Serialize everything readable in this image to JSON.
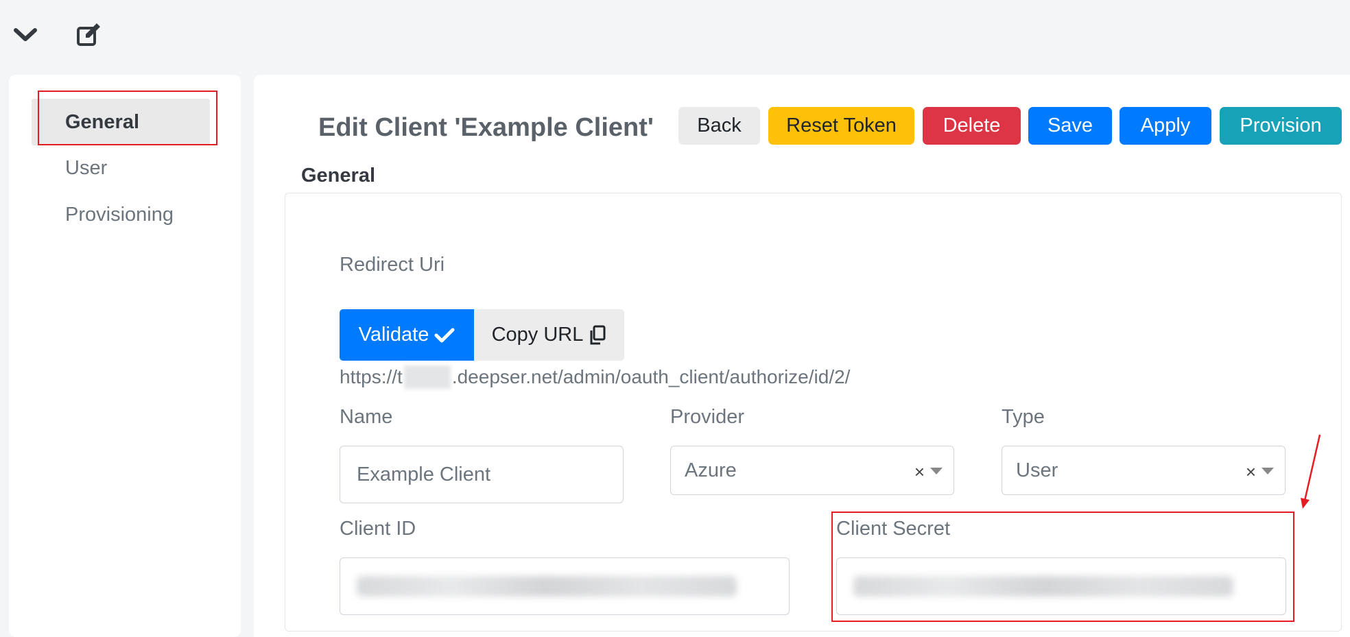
{
  "sidebar": {
    "items": [
      {
        "label": "General"
      },
      {
        "label": "User"
      },
      {
        "label": "Provisioning"
      }
    ]
  },
  "header": {
    "title": "Edit Client 'Example Client'",
    "buttons": {
      "back": "Back",
      "reset_token": "Reset Token",
      "delete": "Delete",
      "save": "Save",
      "apply": "Apply",
      "provision": "Provision"
    }
  },
  "section": {
    "title": "General"
  },
  "form": {
    "redirect_uri_label": "Redirect Uri",
    "validate_label": "Validate",
    "copy_url_label": "Copy URL",
    "url_prefix": "https://t",
    "url_suffix": ".deepser.net/admin/oauth_client/authorize/id/2/",
    "name_label": "Name",
    "name_value": "Example Client",
    "provider_label": "Provider",
    "provider_value": "Azure",
    "type_label": "Type",
    "type_value": "User",
    "client_id_label": "Client ID",
    "client_secret_label": "Client Secret",
    "clear_symbol": "×"
  },
  "colors": {
    "primary": "#007bff",
    "warning": "#ffc107",
    "danger": "#dc3545",
    "info": "#17a2b8",
    "highlight": "#e51c23"
  }
}
